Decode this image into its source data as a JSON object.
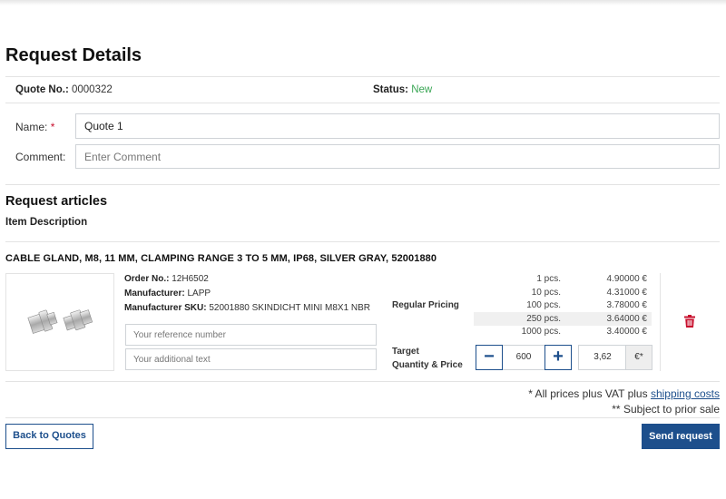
{
  "page": {
    "title": "Request Details"
  },
  "quote": {
    "number_label": "Quote No.:",
    "number_value": "0000322",
    "status_label": "Status:",
    "status_value": "New"
  },
  "form": {
    "name_label": "Name:",
    "name_required_marker": "*",
    "name_value": "Quote 1",
    "comment_label": "Comment:",
    "comment_placeholder": "Enter Comment"
  },
  "articles": {
    "heading": "Request articles",
    "column_header": "Item Description",
    "items": [
      {
        "title": "CABLE GLAND, M8, 11 MM, CLAMPING RANGE 3 TO 5 MM, IP68, SILVER GRAY, 52001880",
        "order_no_label": "Order No.:",
        "order_no": "12H6502",
        "manufacturer_label": "Manufacturer:",
        "manufacturer": "LAPP",
        "sku_label": "Manufacturer SKU:",
        "sku": "52001880 SKINDICHT MINI M8X1 NBR",
        "reference_placeholder": "Your reference number",
        "additional_text_placeholder": "Your additional text",
        "regular_pricing_label": "Regular Pricing",
        "price_tiers": [
          {
            "qty": "1 pcs.",
            "price": "4.90000 €"
          },
          {
            "qty": "10 pcs.",
            "price": "4.31000 €"
          },
          {
            "qty": "100 pcs.",
            "price": "3.78000 €"
          },
          {
            "qty": "250 pcs.",
            "price": "3.64000 €"
          },
          {
            "qty": "1000 pcs.",
            "price": "3.40000 €"
          }
        ],
        "target_label_line1": "Target",
        "target_label_line2": "Quantity & Price",
        "minus_symbol": "−",
        "plus_symbol": "+",
        "target_quantity": "600",
        "target_price": "3,62",
        "currency_label": "€*"
      }
    ]
  },
  "footer": {
    "vat_prefix": "* All prices plus VAT plus ",
    "shipping_link": "shipping costs",
    "prior_sale": "** Subject to prior sale"
  },
  "actions": {
    "back_label": "Back to Quotes",
    "send_label": "Send request"
  },
  "colors": {
    "brand": "#1d4f8c",
    "status_new": "#3aa655",
    "delete": "#c8102e"
  }
}
